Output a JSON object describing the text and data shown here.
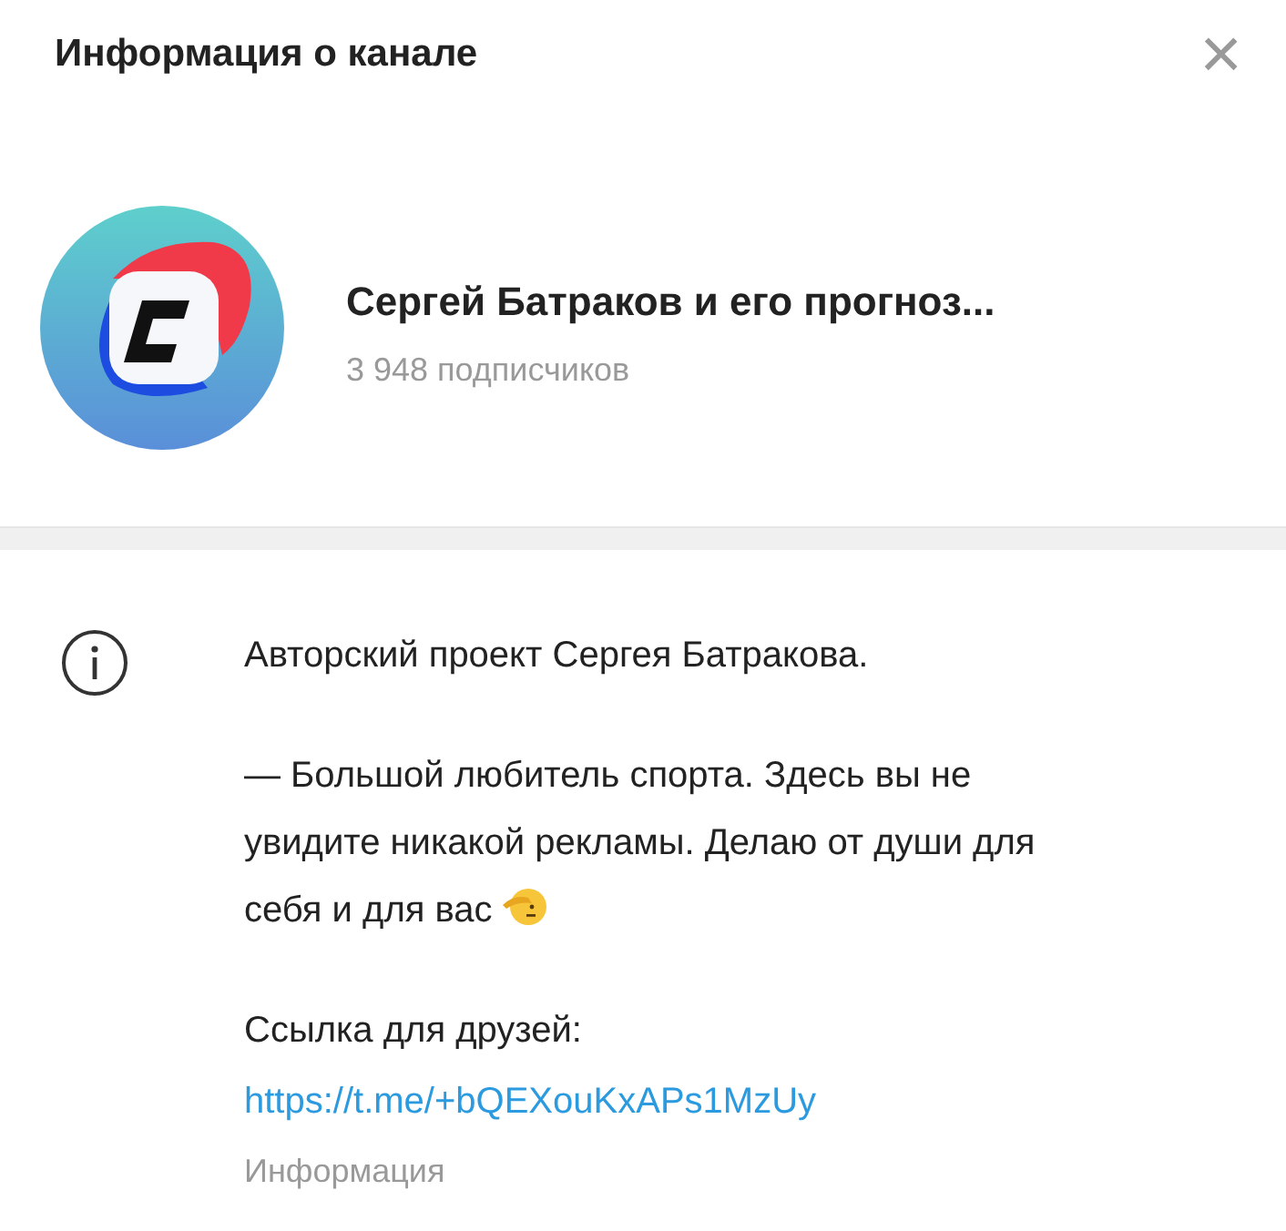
{
  "header": {
    "title": "Информация о канале",
    "close": "×"
  },
  "channel": {
    "name": "Сергей Батраков и его прогноз...",
    "subscribers": "3 948 подписчиков"
  },
  "info": {
    "paragraphs": [
      "Авторский проект Сергея Батракова.",
      "— Большой любитель спорта. Здесь вы не увидите никакой рекламы. Делаю от души для себя и для вас",
      "Ссылка для друзей:"
    ],
    "link": "https://t.me/+bQEXouKxAPs1MzUy",
    "caption": "Информация"
  }
}
